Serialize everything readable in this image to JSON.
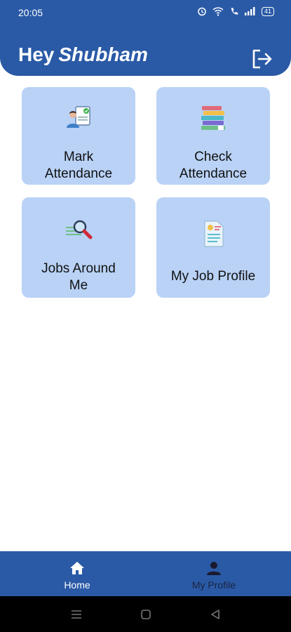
{
  "status": {
    "time": "20:05",
    "battery": "41"
  },
  "header": {
    "greeting": "Hey",
    "name": "Shubham",
    "logout_icon": "logout-icon"
  },
  "cards": [
    {
      "line1": "Mark",
      "line2": "Attendance",
      "icon": "attendance-person-icon"
    },
    {
      "line1": "Check",
      "line2": "Attendance",
      "icon": "books-stack-icon"
    },
    {
      "line1": "Jobs Around",
      "line2": "Me",
      "icon": "search-magnifier-icon"
    },
    {
      "line1": "My Job Profile",
      "icon": "resume-document-icon"
    }
  ],
  "nav": [
    {
      "label": "Home",
      "icon": "home-icon"
    },
    {
      "label": "My Profile",
      "icon": "person-icon"
    }
  ],
  "colors": {
    "primary": "#2a5aa6",
    "card": "#b9d2f6",
    "text": "#111111"
  }
}
